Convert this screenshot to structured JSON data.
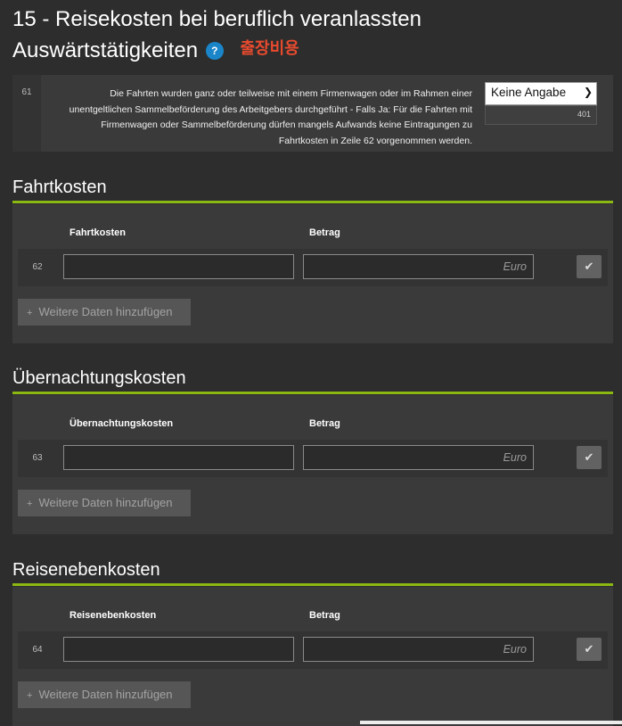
{
  "page": {
    "title": "15 - Reisekosten bei beruflich veranlassten Auswärtstätigkeiten",
    "help_symbol": "?",
    "annotation": "출장비용"
  },
  "question": {
    "number": "61",
    "text": "Die Fahrten wurden ganz oder teilweise mit einem Firmenwagen oder im Rahmen einer unentgeltlichen Sammelbeförderung des Arbeitgebers durchgeführt - Falls Ja: Für die Fahrten mit Firmenwagen oder Sammelbeförderung dürfen mangels Aufwands keine Eintragungen zu Fahrtkosten in Zeile 62 vorgenommen werden.",
    "select_value": "Keine Angabe",
    "code": "401"
  },
  "sections": [
    {
      "title": "Fahrtkosten",
      "col_label": "Fahrtkosten",
      "amount_label": "Betrag",
      "row_number": "62",
      "unit": "Euro",
      "add_label": "Weitere Daten hinzufügen"
    },
    {
      "title": "Übernachtungskosten",
      "col_label": "Übernachtungskosten",
      "amount_label": "Betrag",
      "row_number": "63",
      "unit": "Euro",
      "add_label": "Weitere Daten hinzufügen"
    },
    {
      "title": "Reisenebenkosten",
      "col_label": "Reisenebenkosten",
      "amount_label": "Betrag",
      "row_number": "64",
      "unit": "Euro",
      "add_label": "Weitere Daten hinzufügen"
    }
  ],
  "colors": {
    "accent_green": "#8cb814",
    "help_blue": "#1a85c8",
    "annotation_red": "#e84a2e"
  },
  "icons": {
    "help": "question-circle-icon",
    "dropdown": "chevron-down-icon",
    "check": "checkmark-icon",
    "add": "plus-icon"
  }
}
